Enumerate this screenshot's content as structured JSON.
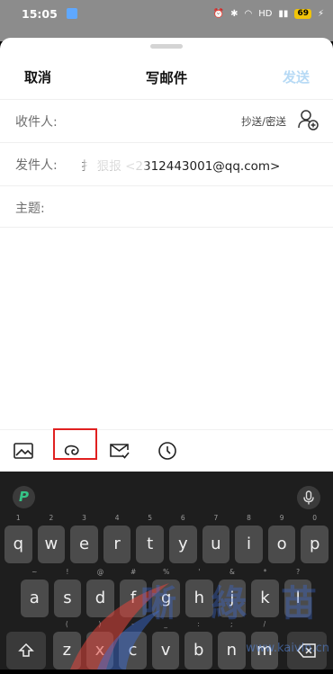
{
  "status_bar": {
    "time": "15:05",
    "right_text": "HD",
    "battery": "69"
  },
  "compose": {
    "cancel_label": "取消",
    "title": "写邮件",
    "send_label": "发送",
    "to_label": "收件人:",
    "cc_bcc_label": "抄送/密送",
    "from_label": "发件人:",
    "from_value": "扌  狠报 <2312443001@qq.com>",
    "subject_label": "主题:"
  },
  "toolbar": {
    "items": [
      "image-icon",
      "attachment-icon",
      "schedule-mail-icon",
      "clock-icon"
    ]
  },
  "keyboard": {
    "row1": [
      {
        "k": "q",
        "s": "1"
      },
      {
        "k": "w",
        "s": "2"
      },
      {
        "k": "e",
        "s": "3"
      },
      {
        "k": "r",
        "s": "4"
      },
      {
        "k": "t",
        "s": "5"
      },
      {
        "k": "y",
        "s": "6"
      },
      {
        "k": "u",
        "s": "7"
      },
      {
        "k": "i",
        "s": "8"
      },
      {
        "k": "o",
        "s": "9"
      },
      {
        "k": "p",
        "s": "0"
      }
    ],
    "row2": [
      {
        "k": "a",
        "s": "~"
      },
      {
        "k": "s",
        "s": "!"
      },
      {
        "k": "d",
        "s": "@"
      },
      {
        "k": "f",
        "s": "#"
      },
      {
        "k": "g",
        "s": "%"
      },
      {
        "k": "h",
        "s": "'"
      },
      {
        "k": "j",
        "s": "&"
      },
      {
        "k": "k",
        "s": "*"
      },
      {
        "k": "l",
        "s": "?"
      }
    ],
    "row3": [
      {
        "k": "z",
        "s": "("
      },
      {
        "k": "x",
        "s": ")"
      },
      {
        "k": "c",
        "s": "-"
      },
      {
        "k": "v",
        "s": "_"
      },
      {
        "k": "b",
        "s": ":"
      },
      {
        "k": "n",
        "s": ";"
      },
      {
        "k": "m",
        "s": "/"
      }
    ]
  },
  "watermark": {
    "text": "晰 綠 苗",
    "url": "www.kaivin.cn"
  },
  "colors": {
    "send_disabled": "#b7daf5",
    "highlight": "#e02020",
    "keyboard_bg": "#1e1e1e",
    "key_bg": "#4b4b4b"
  }
}
